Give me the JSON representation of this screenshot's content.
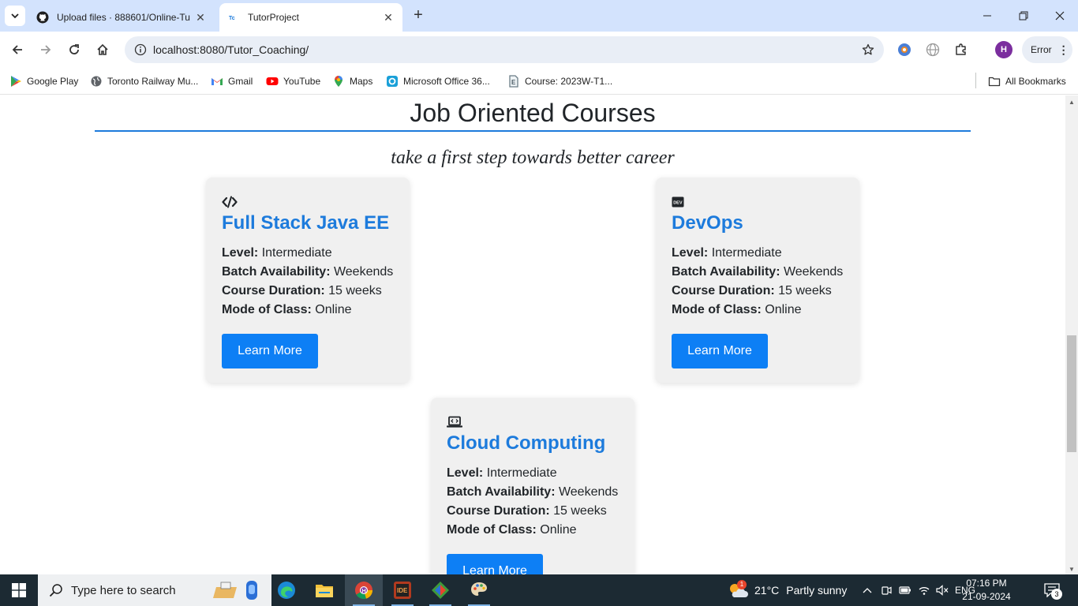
{
  "browser": {
    "tabs": [
      {
        "title": "Upload files · 888601/Online-Tu",
        "favicon": "github-icon"
      },
      {
        "title": "TutorProject",
        "favicon": "tutorproject-icon",
        "active": true
      }
    ],
    "url": "localhost:8080/Tutor_Coaching/",
    "profile_initial": "H",
    "error_label": "Error",
    "bookmarks": [
      {
        "label": "Google Play",
        "icon": "google-play-icon"
      },
      {
        "label": "Toronto Railway Mu...",
        "icon": "globe-icon"
      },
      {
        "label": "Gmail",
        "icon": "gmail-icon"
      },
      {
        "label": "YouTube",
        "icon": "youtube-icon"
      },
      {
        "label": "Maps",
        "icon": "maps-icon"
      },
      {
        "label": "Microsoft Office 36...",
        "icon": "office-icon"
      },
      {
        "label": "Course: 2023W-T1...",
        "icon": "course-icon"
      }
    ],
    "all_bookmarks_label": "All Bookmarks"
  },
  "page": {
    "heading": "Job Oriented Courses",
    "tagline": "take a first step towards better career",
    "fact_labels": {
      "level": "Level:",
      "batch": "Batch Availability:",
      "duration": "Course Duration:",
      "mode": "Mode of Class:"
    },
    "courses": [
      {
        "icon": "code-icon",
        "title": "Full Stack Java EE",
        "level": "Intermediate",
        "batch": "Weekends",
        "duration": "15 weeks",
        "mode": "Online",
        "button": "Learn More"
      },
      {
        "icon": "dev-icon",
        "title": "DevOps",
        "level": "Intermediate",
        "batch": "Weekends",
        "duration": "15 weeks",
        "mode": "Online",
        "button": "Learn More"
      },
      {
        "icon": "laptop-code-icon",
        "title": "Cloud Computing",
        "level": "Intermediate",
        "batch": "Weekends",
        "duration": "15 weeks",
        "mode": "Online",
        "button": "Learn More"
      }
    ],
    "colors": {
      "accent": "#1d7bdc",
      "button": "#0d7ff5",
      "card_bg": "#f0f0f0"
    }
  },
  "taskbar": {
    "search_placeholder": "Type here to search",
    "weather_temp": "21°C",
    "weather_desc": "Partly sunny",
    "weather_badge": "1",
    "language": "ENG",
    "time": "07:16 PM",
    "date": "21-09-2024",
    "notifications": "3"
  }
}
